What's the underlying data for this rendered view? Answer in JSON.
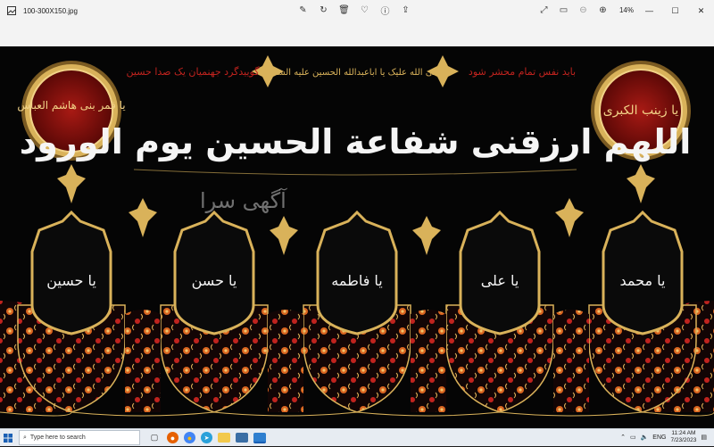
{
  "window": {
    "title": "100-300X150.jpg",
    "zoom": "14%"
  },
  "toolbar": {
    "icons": [
      "edit-icon",
      "rotate-icon",
      "delete-icon",
      "favorite-icon",
      "info-icon",
      "share-icon"
    ],
    "right_icons": [
      "fullscreen-icon",
      "slideshow-icon",
      "zoom-out-icon",
      "zoom-in-icon"
    ]
  },
  "banner": {
    "top_left_text": "گوییدگرد جهنمیان یک صدا حسین",
    "top_center_text": "صلی الله علیک یا اباعبدالله الحسین علیه السلام",
    "top_right_text": "باید نفس تمام محشر شود",
    "main_text": "اللهم ارزقنی شفاعة الحسین یوم الورود",
    "left_medallion": "یا قمر بنی هاشم العباس",
    "right_medallion": "یا زینب الکبری",
    "names": [
      "یا حسین",
      "یا حسن",
      "یا فاطمه",
      "یا علی",
      "یا محمد"
    ],
    "watermark": "آگهی سرا",
    "colors": {
      "background": "#050505",
      "gold": "#d9b25a",
      "red": "#c0231e",
      "orange": "#d9641f"
    }
  },
  "taskbar": {
    "search_placeholder": "Type here to search",
    "language": "ENG",
    "time": "11:24 AM",
    "date": "7/23/2023"
  }
}
